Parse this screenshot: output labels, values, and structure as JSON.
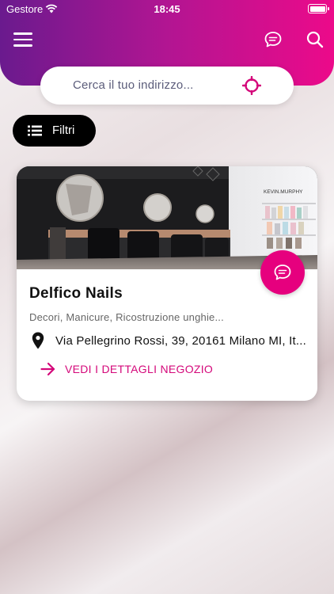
{
  "status_bar": {
    "carrier": "Gestore",
    "time": "18:45"
  },
  "header": {
    "menu_icon": "hamburger-icon",
    "chat_icon": "chat-bubble-icon",
    "search_icon": "search-icon",
    "gradient": [
      "#6a1a8e",
      "#ec0a8a"
    ]
  },
  "search": {
    "placeholder": "Cerca il tuo indirizzo...",
    "icon": "location-target-icon"
  },
  "filters": {
    "label": "Filtri",
    "icon": "list-icon"
  },
  "card": {
    "name": "Delfico Nails",
    "categories": "Decori, Manicure, Ricostruzione unghie...",
    "address": "Via Pellegrino Rossi, 39, 20161 Milano MI, It...",
    "details_label": "VEDI I DETTAGLI NEGOZIO",
    "chat_icon": "chat-bubble-icon",
    "photo_sign": "KEVIN.MURPHY"
  },
  "colors": {
    "accent": "#e6007e",
    "text": "#111111"
  }
}
